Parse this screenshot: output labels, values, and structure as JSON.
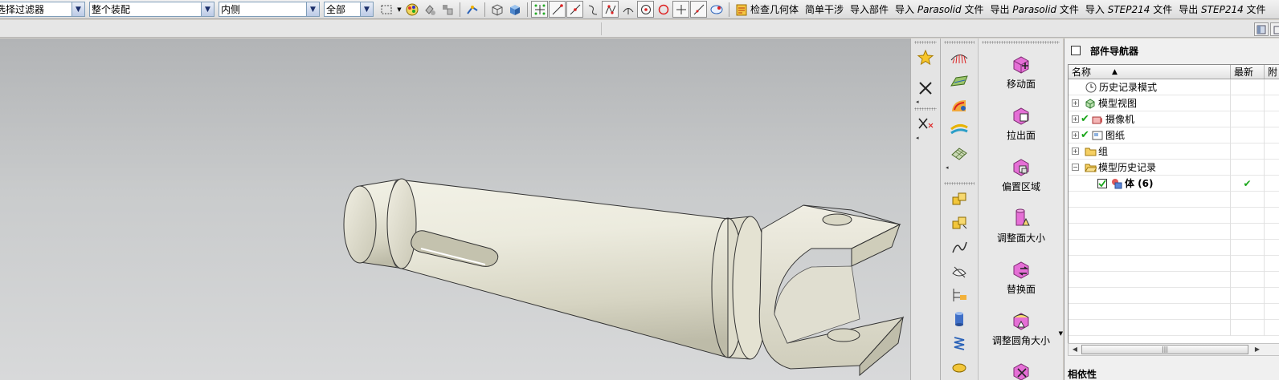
{
  "toolbar": {
    "filter_value": "选择过滤器",
    "assembly_value": "整个装配",
    "inside_value": "内侧",
    "all_value": "全部",
    "text_buttons": [
      "检查几何体",
      "简单干涉",
      "导入部件",
      "导入 ",
      "Parasolid",
      " 文件",
      "导出 ",
      "Parasolid",
      " 文件",
      "导入 ",
      "STEP214",
      " 文件",
      "导出 ",
      "STEP214",
      " 文件"
    ]
  },
  "commands": [
    {
      "label": "移动面",
      "icon": "move-face-icon"
    },
    {
      "label": "拉出面",
      "icon": "pull-face-icon"
    },
    {
      "label": "偏置区域",
      "icon": "offset-region-icon"
    },
    {
      "label": "调整面大小",
      "icon": "resize-face-icon"
    },
    {
      "label": "替换面",
      "icon": "replace-face-icon"
    },
    {
      "label": "调整圆角大小",
      "icon": "resize-blend-icon"
    }
  ],
  "navigator": {
    "title": "部件导航器",
    "columns": {
      "name": "名称",
      "latest": "最新",
      "attached": "附"
    },
    "rows": [
      {
        "label": "历史记录模式",
        "icon": "clock-icon",
        "latest": ""
      },
      {
        "label": "模型视图",
        "icon": "model-view-icon",
        "latest": ""
      },
      {
        "label": "摄像机",
        "icon": "camera-icon",
        "latest": ""
      },
      {
        "label": "图纸",
        "icon": "drawing-icon",
        "latest": ""
      },
      {
        "label": "组",
        "icon": "folder-icon",
        "latest": ""
      },
      {
        "label": "模型历史记录",
        "icon": "folder-icon",
        "latest": ""
      },
      {
        "label": "体 (6)",
        "icon": "body-icon",
        "latest": "✔"
      }
    ],
    "bottom_label": "相依性"
  },
  "colors": {
    "accent_check": "#1aa61a",
    "viewport_top": "#b2b4b6",
    "viewport_bottom": "#d8d9da",
    "model_fill": "#e7e5d6"
  }
}
